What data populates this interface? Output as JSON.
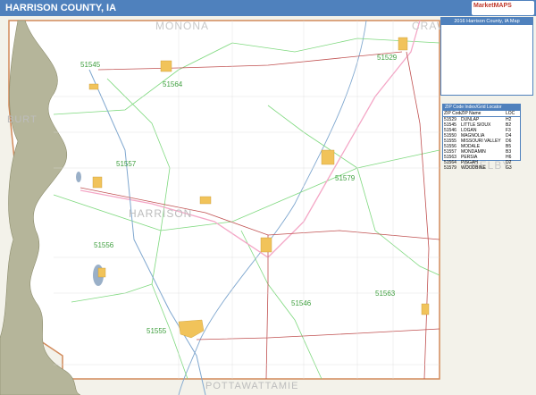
{
  "title": "HARRISON COUNTY, IA",
  "logo_text": "MarketMAPS",
  "legend": {
    "title": "2016 Harrison County, IA Map"
  },
  "locator": {
    "title": "ZIP Code Index/Grid Locator",
    "headers": [
      "ZIP Code",
      "ZIP Name",
      "LOC"
    ],
    "rows": [
      [
        "51529",
        "DUNLAP",
        "H2"
      ],
      [
        "51545",
        "LITTLE SIOUX",
        "B2"
      ],
      [
        "51546",
        "LOGAN",
        "F3"
      ],
      [
        "51550",
        "MAGNOLIA",
        "D4"
      ],
      [
        "51555",
        "MISSOURI VALLEY",
        "D6"
      ],
      [
        "51556",
        "MODALE",
        "B5"
      ],
      [
        "51557",
        "MONDAMIN",
        "B3"
      ],
      [
        "51563",
        "PERSIA",
        "H6"
      ],
      [
        "51564",
        "PISGAH",
        "D2"
      ],
      [
        "51579",
        "WOODBINE",
        "G3"
      ]
    ]
  },
  "map": {
    "county_name": "HARRISON",
    "neighbors": {
      "north": "MONONA",
      "northeast": "CRAW",
      "west": "BURT",
      "east": "SHELBY",
      "south": "POTTAWATTAMIE"
    },
    "zip_labels": [
      "51545",
      "51529",
      "51564",
      "51557",
      "51579",
      "51556",
      "51563",
      "51546",
      "51555"
    ],
    "colors": {
      "land": "#ffffff",
      "outside": "#f0efe6",
      "river": "#a8a88a",
      "zip_boundary": "#7fd97f",
      "county_boundary": "#d28a5a",
      "highway": "#f4a6c6",
      "road": "#c05050",
      "town": "#f1c35a",
      "label": "#40a040"
    }
  }
}
